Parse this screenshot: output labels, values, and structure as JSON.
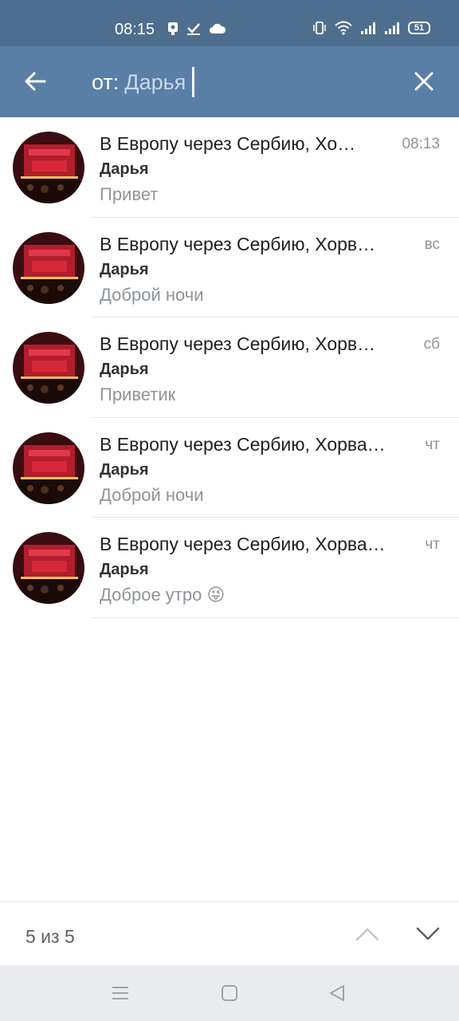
{
  "status_bar": {
    "time": "08:15",
    "left_icons": [
      "camera-icon",
      "check-icon",
      "cloud-icon"
    ],
    "right_icons": [
      "vibrate-icon",
      "wifi-icon",
      "signal-icon",
      "signal-icon"
    ],
    "battery": "51"
  },
  "search": {
    "prefix": "от:",
    "value": "Дарья"
  },
  "colors": {
    "status_bar": "#4e6e8f",
    "app_bar": "#5a7fa6",
    "accent_text": "#c5d8ec"
  },
  "results": [
    {
      "title": "В Европу через Сербию, Хо…",
      "time": "08:13",
      "sender": "Дарья",
      "message": "Привет",
      "emoji": ""
    },
    {
      "title": "В Европу через Сербию, Хорв…",
      "time": "вс",
      "sender": "Дарья",
      "message": "Доброй ночи",
      "emoji": ""
    },
    {
      "title": "В Европу через Сербию, Хорв…",
      "time": "сб",
      "sender": "Дарья",
      "message": "Приветик",
      "emoji": ""
    },
    {
      "title": "В Европу через Сербию, Хорва…",
      "time": "чт",
      "sender": "Дарья",
      "message": "Доброй ночи",
      "emoji": ""
    },
    {
      "title": "В Европу через Сербию, Хорва…",
      "time": "чт",
      "sender": "Дарья",
      "message": "Доброе утро",
      "emoji": "😜"
    }
  ],
  "footer": {
    "counter": "5 из 5"
  }
}
